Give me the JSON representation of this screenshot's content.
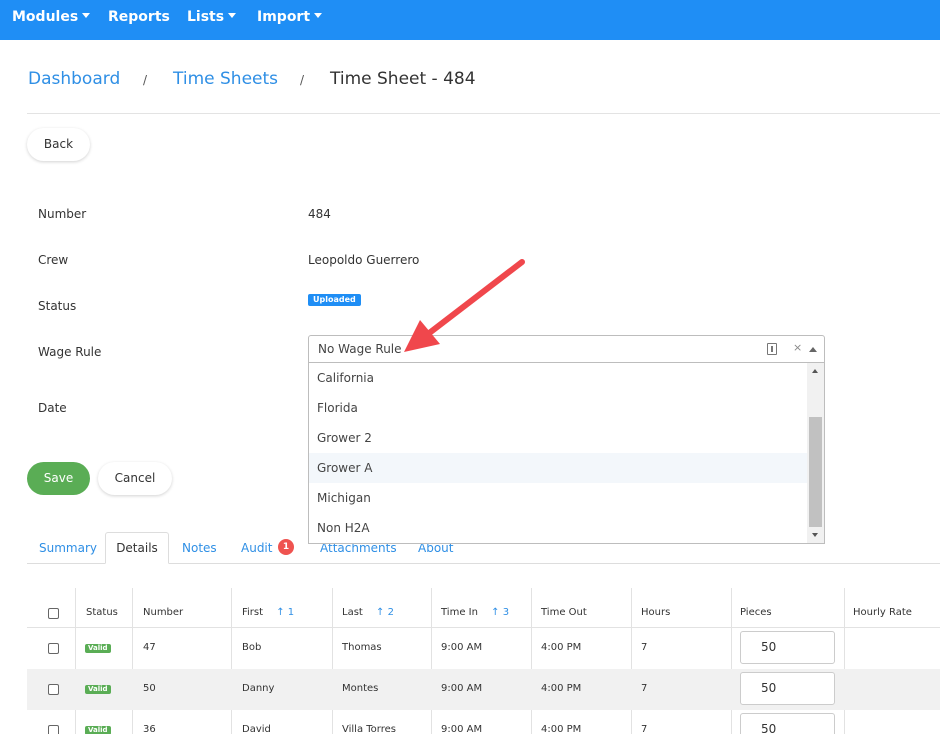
{
  "nav": {
    "items": [
      {
        "label": "Modules",
        "has_caret": true
      },
      {
        "label": "Reports",
        "has_caret": false
      },
      {
        "label": "Lists",
        "has_caret": true
      },
      {
        "label": "Import",
        "has_caret": true
      }
    ]
  },
  "breadcrumb": {
    "home": "Dashboard",
    "sep": "/",
    "section": "Time Sheets",
    "current": "Time Sheet - 484"
  },
  "back_label": "Back",
  "form": {
    "number_label": "Number",
    "number_value": "484",
    "crew_label": "Crew",
    "crew_value": "Leopoldo Guerrero",
    "status_label": "Status",
    "status_value": "Uploaded",
    "wage_rule_label": "Wage Rule",
    "wage_rule_value": "No Wage Rule",
    "wage_rule_options": [
      "California",
      "Florida",
      "Grower 2",
      "Grower A",
      "Michigan",
      "Non H2A"
    ],
    "wage_rule_highlighted": "Grower A",
    "date_label": "Date",
    "clear_glyph": "×"
  },
  "actions": {
    "save_label": "Save",
    "cancel_label": "Cancel"
  },
  "tabs": {
    "summary": "Summary",
    "details": "Details",
    "notes": "Notes",
    "audit": "Audit",
    "audit_count": "1",
    "attachments": "Attachments",
    "about": "About"
  },
  "table": {
    "headers": {
      "status": "Status",
      "number": "Number",
      "first": "First",
      "first_sort": "↑ 1",
      "last": "Last",
      "last_sort": "↑ 2",
      "time_in": "Time In",
      "time_in_sort": "↑ 3",
      "time_out": "Time Out",
      "hours": "Hours",
      "pieces": "Pieces",
      "hourly_rate": "Hourly Rate"
    },
    "rows": [
      {
        "status": "Valid",
        "number": "47",
        "first": "Bob",
        "last": "Thomas",
        "time_in": "9:00 AM",
        "time_out": "4:00 PM",
        "hours": "7",
        "pieces": "50"
      },
      {
        "status": "Valid",
        "number": "50",
        "first": "Danny",
        "last": "Montes",
        "time_in": "9:00 AM",
        "time_out": "4:00 PM",
        "hours": "7",
        "pieces": "50"
      },
      {
        "status": "Valid",
        "number": "36",
        "first": "David",
        "last": "Villa Torres",
        "time_in": "9:00 AM",
        "time_out": "4:00 PM",
        "hours": "7",
        "pieces": "50"
      }
    ]
  },
  "colors": {
    "primary": "#1f8ef5",
    "link": "#2f8fe5",
    "success": "#5aad55",
    "danger": "#ef5350",
    "annotation_arrow": "#f0474c"
  }
}
